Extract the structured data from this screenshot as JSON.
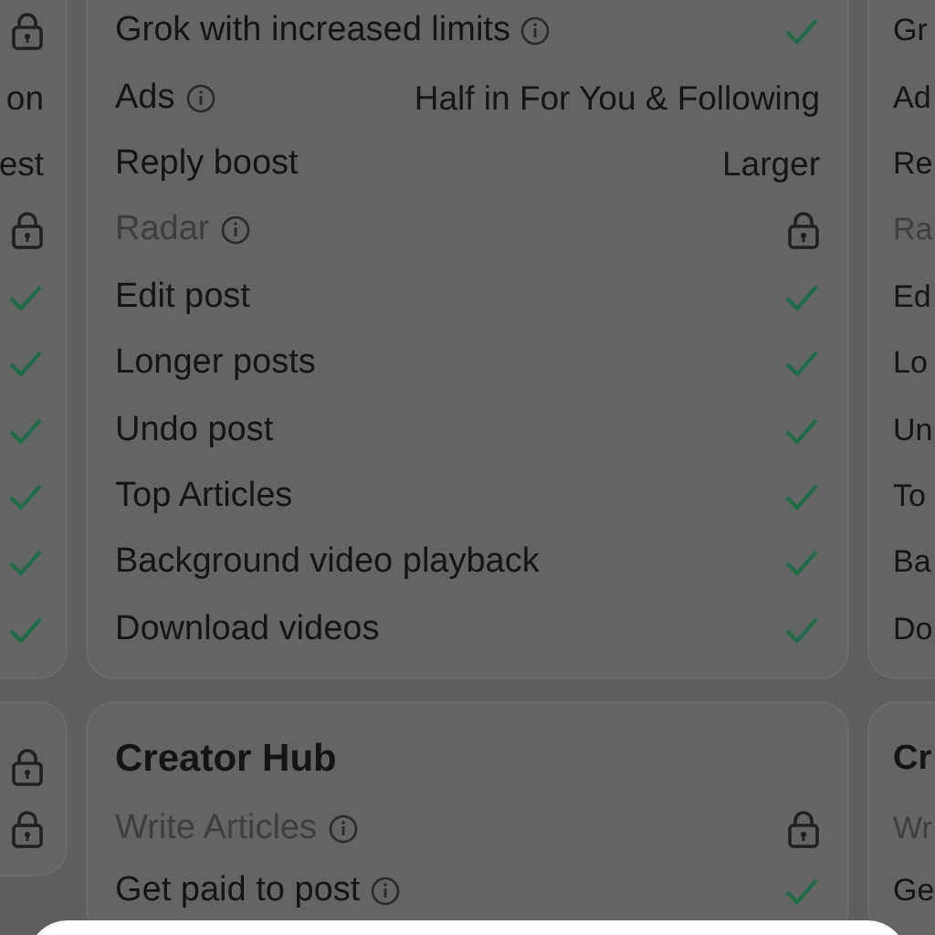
{
  "columns": [
    {
      "sections": [
        {
          "rows": [
            {
              "kind": "lock"
            },
            {
              "kind": "text",
              "value": "on"
            },
            {
              "kind": "text",
              "value": "est"
            },
            {
              "kind": "lock"
            },
            {
              "kind": "check"
            },
            {
              "kind": "check"
            },
            {
              "kind": "check"
            },
            {
              "kind": "check"
            },
            {
              "kind": "check"
            },
            {
              "kind": "check"
            }
          ]
        },
        {
          "rows": [
            {
              "kind": "lock"
            },
            {
              "kind": "lock"
            }
          ]
        }
      ]
    },
    {
      "sections": [
        {
          "rows": [
            {
              "label": "Grok with increased limits",
              "info": true,
              "disabled": false,
              "kind": "check"
            },
            {
              "label": "Ads",
              "info": true,
              "disabled": false,
              "kind": "text",
              "value": "Half in For You & Following"
            },
            {
              "label": "Reply boost",
              "info": false,
              "disabled": false,
              "kind": "text",
              "value": "Larger"
            },
            {
              "label": "Radar",
              "info": true,
              "disabled": true,
              "kind": "lock"
            },
            {
              "label": "Edit post",
              "info": false,
              "disabled": false,
              "kind": "check"
            },
            {
              "label": "Longer posts",
              "info": false,
              "disabled": false,
              "kind": "check"
            },
            {
              "label": "Undo post",
              "info": false,
              "disabled": false,
              "kind": "check"
            },
            {
              "label": "Top Articles",
              "info": false,
              "disabled": false,
              "kind": "check"
            },
            {
              "label": "Background video playback",
              "info": false,
              "disabled": false,
              "kind": "check"
            },
            {
              "label": "Download videos",
              "info": false,
              "disabled": false,
              "kind": "check"
            }
          ]
        },
        {
          "title": "Creator Hub",
          "rows": [
            {
              "label": "Write Articles",
              "info": true,
              "disabled": true,
              "kind": "lock"
            },
            {
              "label": "Get paid to post",
              "info": true,
              "disabled": false,
              "kind": "check"
            }
          ]
        }
      ]
    },
    {
      "sections": [
        {
          "rows": [
            {
              "label": "Gr",
              "disabled": false
            },
            {
              "label": "Ad",
              "disabled": false
            },
            {
              "label": "Re",
              "disabled": false
            },
            {
              "label": "Ra",
              "disabled": true
            },
            {
              "label": "Ed",
              "disabled": false
            },
            {
              "label": "Lo",
              "disabled": false
            },
            {
              "label": "Un",
              "disabled": false
            },
            {
              "label": "To",
              "disabled": false
            },
            {
              "label": "Ba",
              "disabled": false
            },
            {
              "label": "Do",
              "disabled": false
            }
          ]
        },
        {
          "title": "Cr",
          "rows": [
            {
              "label": "Wr",
              "disabled": true
            },
            {
              "label": "Ge",
              "disabled": false
            }
          ]
        }
      ]
    }
  ]
}
